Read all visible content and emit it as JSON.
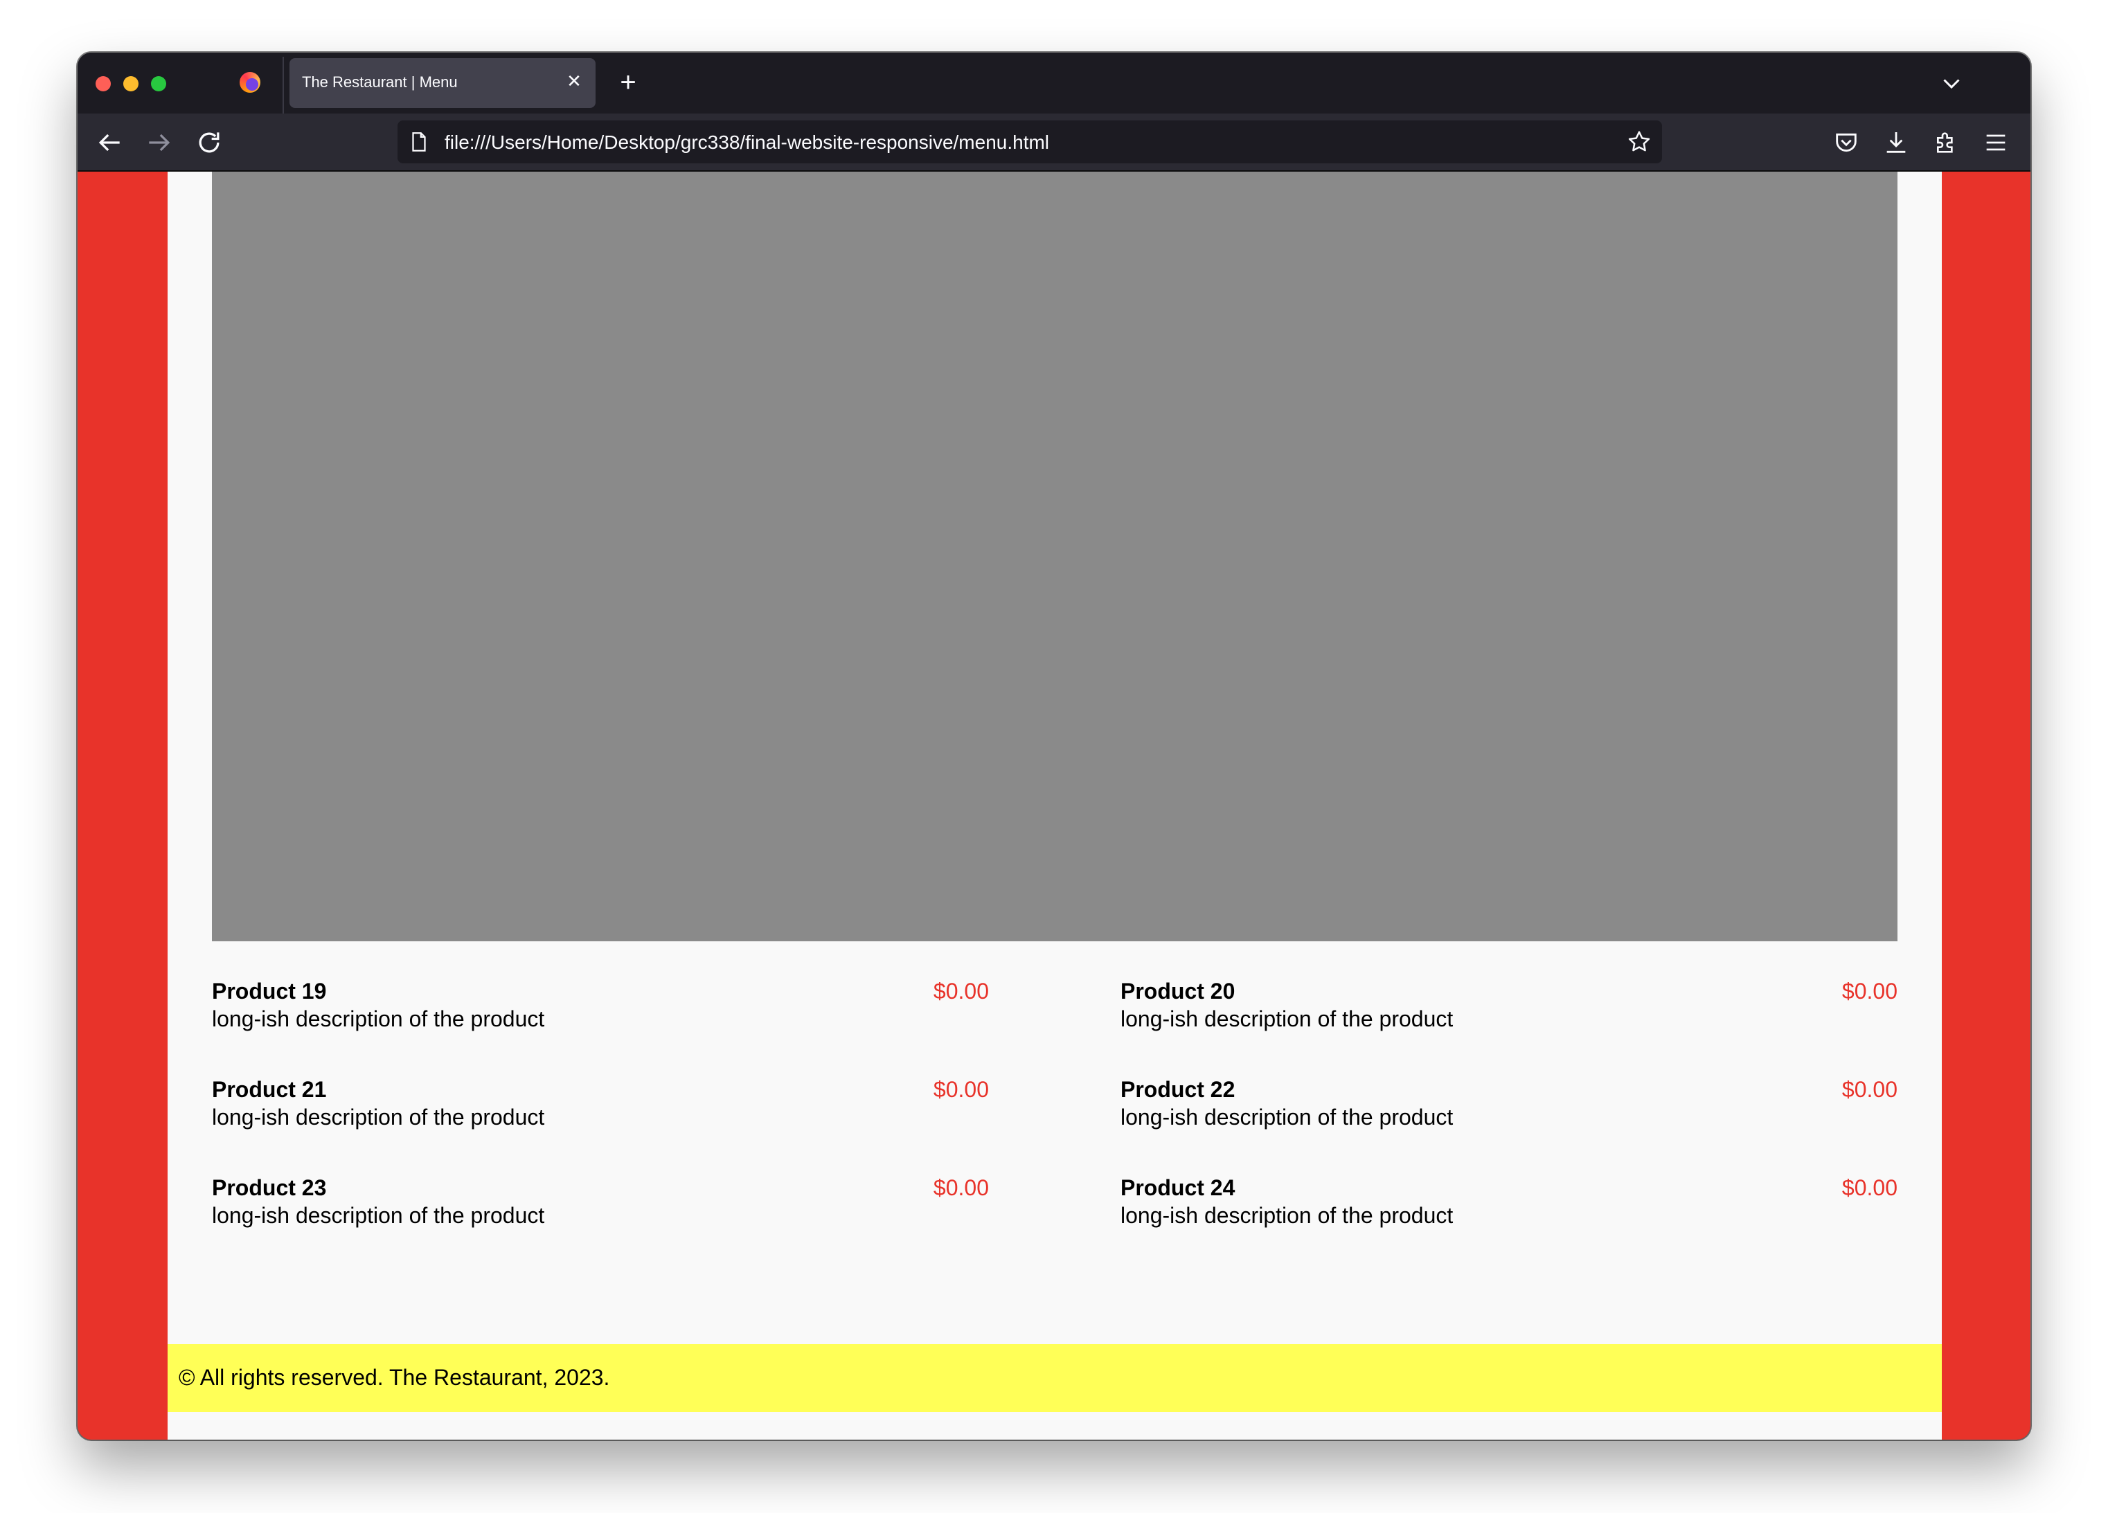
{
  "browser": {
    "tab_title": "The Restaurant | Menu",
    "url": "file:///Users/Home/Desktop/grc338/final-website-responsive/menu.html",
    "icons": {
      "close": "close-icon",
      "new_tab": "plus-icon",
      "tab_list": "chevron-down-icon",
      "back": "back-arrow-icon",
      "forward": "forward-arrow-icon",
      "reload": "reload-icon",
      "page": "page-icon",
      "bookmark": "star-icon",
      "pocket": "pocket-icon",
      "downloads": "download-icon",
      "extensions": "puzzle-icon",
      "menu": "hamburger-menu-icon"
    }
  },
  "menu": {
    "items": [
      {
        "name": "Product 19",
        "description": "long-ish description of the product",
        "price": "$0.00"
      },
      {
        "name": "Product 20",
        "description": "long-ish description of the product",
        "price": "$0.00"
      },
      {
        "name": "Product 21",
        "description": "long-ish description of the product",
        "price": "$0.00"
      },
      {
        "name": "Product 22",
        "description": "long-ish description of the product",
        "price": "$0.00"
      },
      {
        "name": "Product 23",
        "description": "long-ish description of the product",
        "price": "$0.00"
      },
      {
        "name": "Product 24",
        "description": "long-ish description of the product",
        "price": "$0.00"
      }
    ]
  },
  "footer": {
    "text": "© All rights reserved. The Restaurant, 2023."
  },
  "colors": {
    "side_background": "#e8332a",
    "page_background": "#f9f9f9",
    "image_placeholder": "#8a8a8a",
    "price": "#e8332a",
    "footer_background": "#ffff57"
  }
}
